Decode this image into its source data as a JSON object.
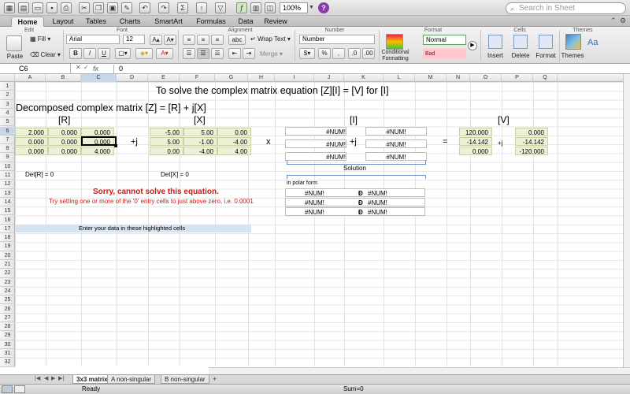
{
  "toolbar": {
    "zoom": "100%",
    "search_placeholder": "Search in Sheet"
  },
  "tabs": [
    "Home",
    "Layout",
    "Tables",
    "Charts",
    "SmartArt",
    "Formulas",
    "Data",
    "Review"
  ],
  "ribbon": {
    "groups": [
      "Edit",
      "Font",
      "Alignment",
      "Number",
      "Format",
      "Cells",
      "Themes"
    ],
    "paste": "Paste",
    "fill": "Fill",
    "clear": "Clear",
    "font_name": "Arial",
    "font_size": "12",
    "bold": "B",
    "italic": "I",
    "underline": "U",
    "abc": "abc",
    "wrap_text": "Wrap Text",
    "merge": "Merge",
    "number_format": "Number",
    "conditional_formatting": "Conditional Formatting",
    "style_normal": "Normal",
    "style_bad": "Bad",
    "insert": "Insert",
    "delete": "Delete",
    "format": "Format",
    "themes": "Themes",
    "aa": "Aa"
  },
  "formula_bar": {
    "name_box": "C6",
    "fx": "fx",
    "value": "0"
  },
  "columns": [
    "A",
    "B",
    "C",
    "D",
    "E",
    "F",
    "G",
    "H",
    "I",
    "J",
    "K",
    "L",
    "M",
    "N",
    "O",
    "P",
    "Q"
  ],
  "rows": [
    "1",
    "2",
    "3",
    "4",
    "5",
    "6",
    "7",
    "8",
    "9",
    "10",
    "11",
    "12",
    "13",
    "14",
    "15",
    "16",
    "17",
    "18",
    "19",
    "20",
    "21",
    "22",
    "23",
    "24",
    "25",
    "26",
    "27",
    "28",
    "29",
    "30",
    "31",
    "32"
  ],
  "sheet": {
    "title": "To solve the complex matrix equation    [Z][I] = [V]  for [I]",
    "subtitle": "Decomposed complex matrix [Z] = [R] + j[X]",
    "r_label": "[R]",
    "x_label": "[X]",
    "i_label": "[I]",
    "v_label": "[V]",
    "plus_j": "+j",
    "times": "x",
    "equals": "=",
    "R": [
      [
        "2.000",
        "0.000",
        "0.000"
      ],
      [
        "0.000",
        "0.000",
        "0.000"
      ],
      [
        "0.000",
        "0.000",
        "4.000"
      ]
    ],
    "X": [
      [
        "-5.00",
        "5.00",
        "0.00"
      ],
      [
        "5.00",
        "-1.00",
        "-4.00"
      ],
      [
        "0.00",
        "-4.00",
        "4.00"
      ]
    ],
    "I_real": [
      "#NUM!",
      "#NUM!",
      "#NUM!"
    ],
    "I_imag": [
      "#NUM!",
      "#NUM!",
      "#NUM!"
    ],
    "V_real": [
      "120.000",
      "-14.142",
      "0.000"
    ],
    "V_imag": [
      "0.000",
      "-14.142",
      "-120.000"
    ],
    "det_r": "Det[R] = 0",
    "det_x": "Det[X] = 0",
    "solution": "Solution",
    "polar_form": "in polar form",
    "polar": [
      [
        "#NUM!",
        "Ð",
        "#NUM!"
      ],
      [
        "#NUM!",
        "Ð",
        "#NUM!"
      ],
      [
        "#NUM!",
        "Ð",
        "#NUM!"
      ]
    ],
    "error_msg": "Sorry, cannot solve this equation.",
    "hint_msg": "Try setting one or more of the '0' entry cells to just above zero, i.e. 0.0001",
    "enter_data": "Enter your data in these highlighted cells"
  },
  "sheet_tabs": [
    "3x3 matrix",
    "A non-singular",
    "B non-singular"
  ],
  "status": {
    "ready": "Ready",
    "sum": "Sum=0"
  },
  "colors": {
    "error_red": "#e01010",
    "input_fill": "#edf1d8",
    "highlight_band": "#d6e3f1",
    "selection": "#c8d6e9"
  }
}
